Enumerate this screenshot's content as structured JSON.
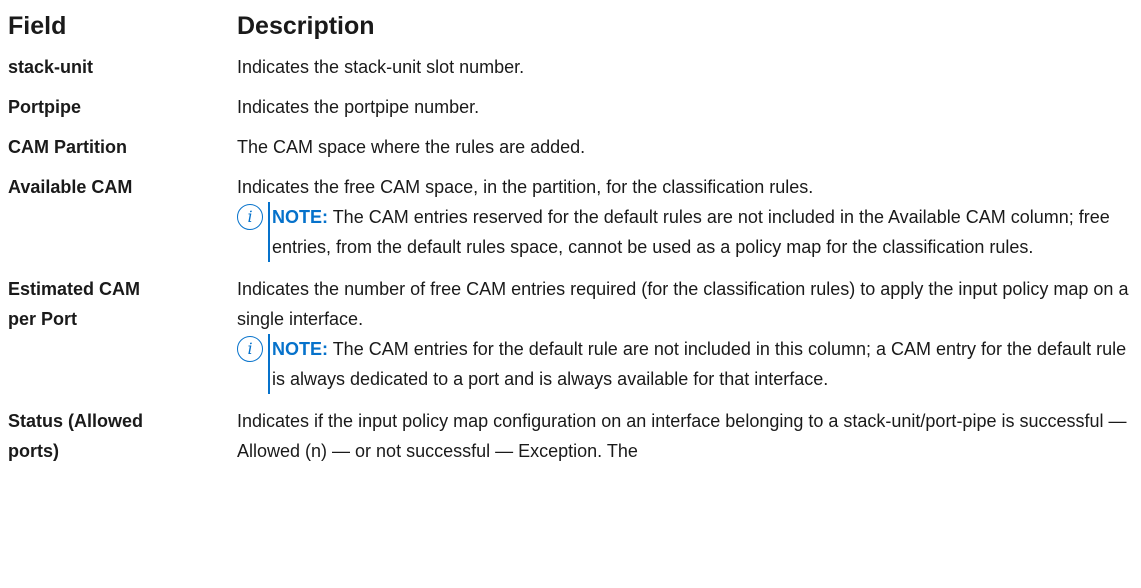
{
  "header": {
    "field": "Field",
    "description": "Description"
  },
  "rows": {
    "r0": {
      "field": "stack-unit",
      "desc": "Indicates the stack-unit slot number."
    },
    "r1": {
      "field": "Portpipe",
      "desc": "Indicates the portpipe number."
    },
    "r2": {
      "field": "CAM Partition",
      "desc": "The CAM space where the rules are added."
    },
    "r3": {
      "field": "Available CAM",
      "desc": "Indicates the free CAM space, in the partition, for the classification rules.",
      "note_label": "NOTE:",
      "note_text": "The CAM entries reserved for the default rules are not included in the Available CAM column; free entries, from the default rules space, cannot be used as a policy map for the classification rules."
    },
    "r4": {
      "field_line1": "Estimated CAM",
      "field_line2": "per Port",
      "desc": "Indicates the number of free CAM entries required (for the classification rules) to apply the input policy map on a single interface.",
      "note_label": "NOTE:",
      "note_text": "The CAM entries for the default rule are not included in this column; a CAM entry for the default rule is always dedicated to a port and is always available for that interface."
    },
    "r5": {
      "field_line1": "Status (Allowed",
      "field_line2": "ports)",
      "desc": "Indicates if the input policy map configuration on an interface belonging to a stack-unit/port-pipe is successful — Allowed (n) — or not successful — Exception. The"
    }
  },
  "icons": {
    "note": "info-icon"
  },
  "colors": {
    "accent": "#0672cb",
    "text": "#1a1a1a"
  }
}
